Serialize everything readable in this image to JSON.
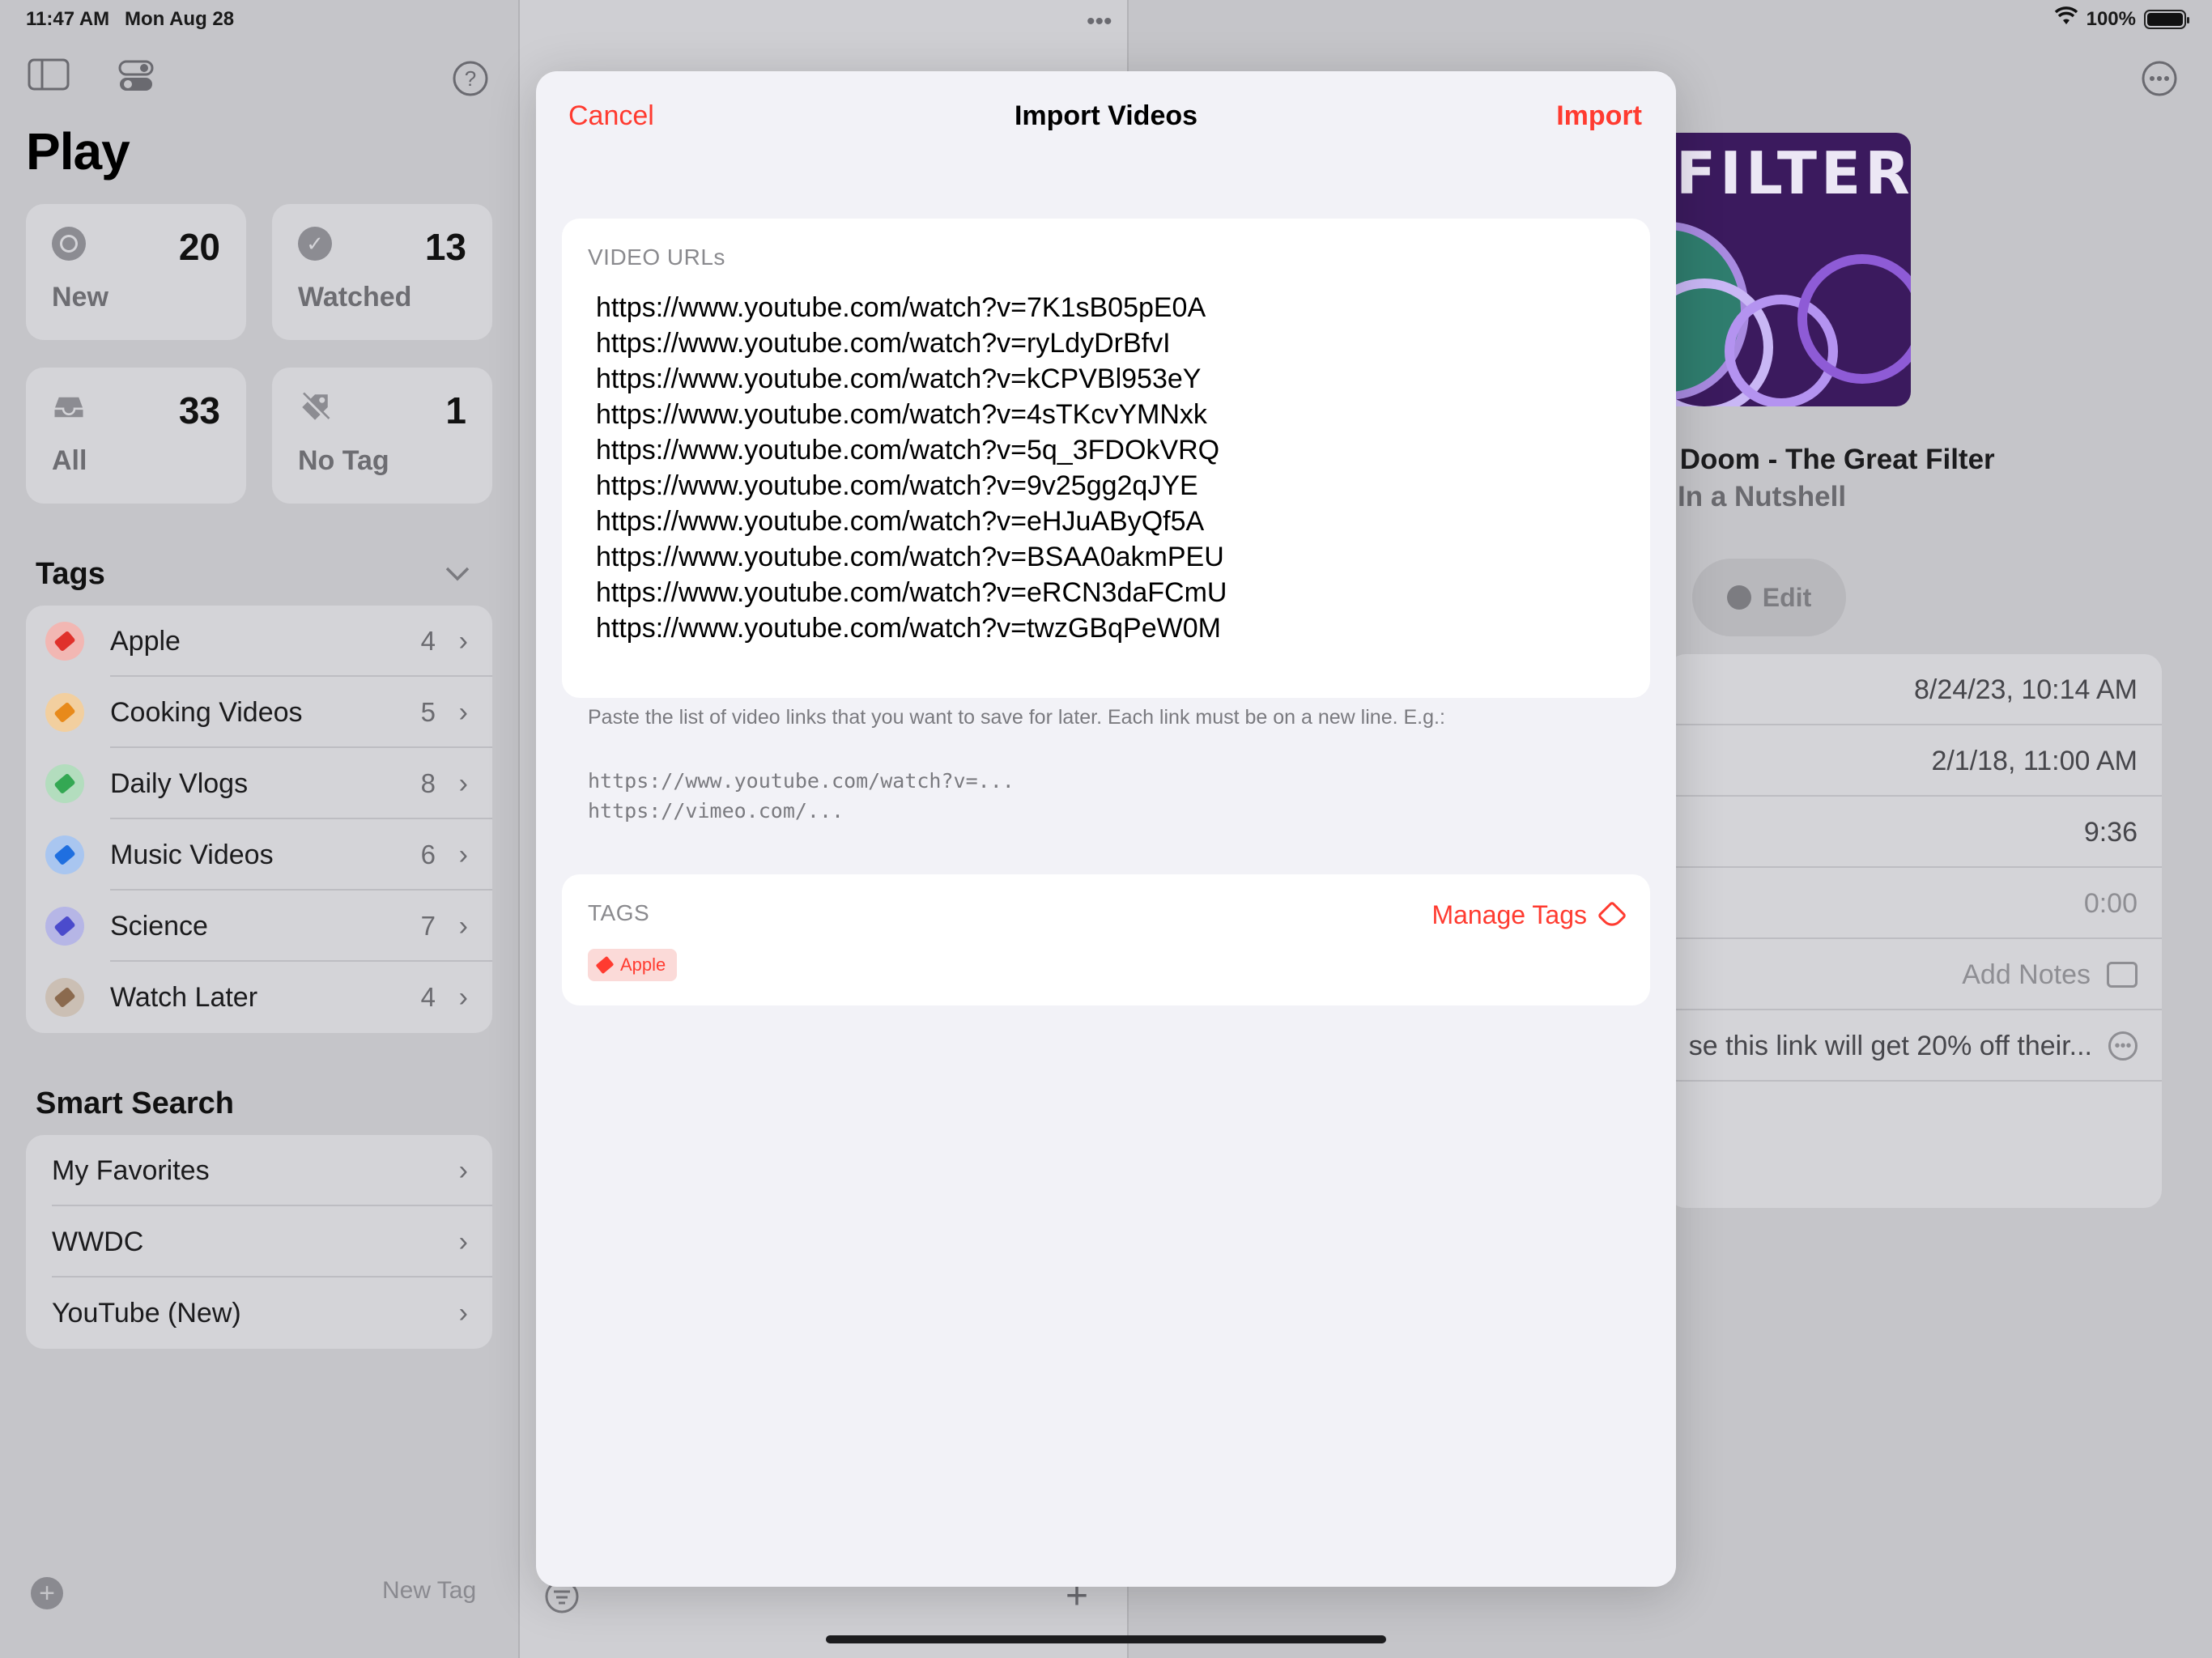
{
  "status_bar": {
    "time": "11:47 AM",
    "date": "Mon Aug 28",
    "battery": "100%"
  },
  "sidebar": {
    "title": "Play",
    "stats": [
      {
        "label": "New",
        "count": "20",
        "icon": "circle-icon"
      },
      {
        "label": "Watched",
        "count": "13",
        "icon": "checkmark-circle-icon"
      },
      {
        "label": "All",
        "count": "33",
        "icon": "tray-icon"
      },
      {
        "label": "No Tag",
        "count": "1",
        "icon": "tag-slash-icon"
      }
    ],
    "tags_header": "Tags",
    "tags": [
      {
        "name": "Apple",
        "count": "4",
        "color": "#e0312b"
      },
      {
        "name": "Cooking Videos",
        "count": "5",
        "color": "#e88a1a"
      },
      {
        "name": "Daily Vlogs",
        "count": "8",
        "color": "#34a853"
      },
      {
        "name": "Music Videos",
        "count": "6",
        "color": "#1f6fe0"
      },
      {
        "name": "Science",
        "count": "7",
        "color": "#4b4bcc"
      },
      {
        "name": "Watch Later",
        "count": "4",
        "color": "#8b6a4e"
      }
    ],
    "smart_search_header": "Smart Search",
    "smart_searches": [
      {
        "name": "My Favorites"
      },
      {
        "name": "WWDC"
      },
      {
        "name": "YouTube (New)"
      }
    ],
    "new_tag_label": "New Tag"
  },
  "detail": {
    "thumbnail_text": "FILTER",
    "title": "ur Doom - The Great Filter",
    "subtitle": "In a Nutshell",
    "edit_label": "Edit",
    "rows": [
      {
        "value": "8/24/23, 10:14 AM"
      },
      {
        "value": "2/1/18, 11:00 AM"
      },
      {
        "value": "9:36"
      },
      {
        "value": "0:00"
      },
      {
        "value": "Add Notes"
      },
      {
        "value": "se this link will get 20% off their..."
      }
    ]
  },
  "modal": {
    "cancel_label": "Cancel",
    "title": "Import Videos",
    "import_label": "Import",
    "urls_header": "VIDEO URLs",
    "urls": [
      "https://www.youtube.com/watch?v=7K1sB05pE0A",
      "https://www.youtube.com/watch?v=ryLdyDrBfvI",
      "https://www.youtube.com/watch?v=kCPVBl953eY",
      "https://www.youtube.com/watch?v=4sTKcvYMNxk",
      "https://www.youtube.com/watch?v=5q_3FDOkVRQ",
      "https://www.youtube.com/watch?v=9v25gg2qJYE",
      "https://www.youtube.com/watch?v=eHJuAByQf5A",
      "https://www.youtube.com/watch?v=BSAA0akmPEU",
      "https://www.youtube.com/watch?v=eRCN3daFCmU",
      "https://www.youtube.com/watch?v=twzGBqPeW0M"
    ],
    "footer_note": "Paste the list of video links that you want to save for later. Each link must be on a new line. E.g.:",
    "footer_examples": [
      "https://www.youtube.com/watch?v=...",
      "https://vimeo.com/..."
    ],
    "tags_header": "TAGS",
    "manage_tags_label": "Manage Tags",
    "selected_tags": [
      {
        "name": "Apple",
        "color": "#ff3b30"
      }
    ]
  },
  "colors": {
    "accent": "#ff3b30",
    "card": "#ffffff",
    "modal_bg": "#f2f2f7"
  }
}
